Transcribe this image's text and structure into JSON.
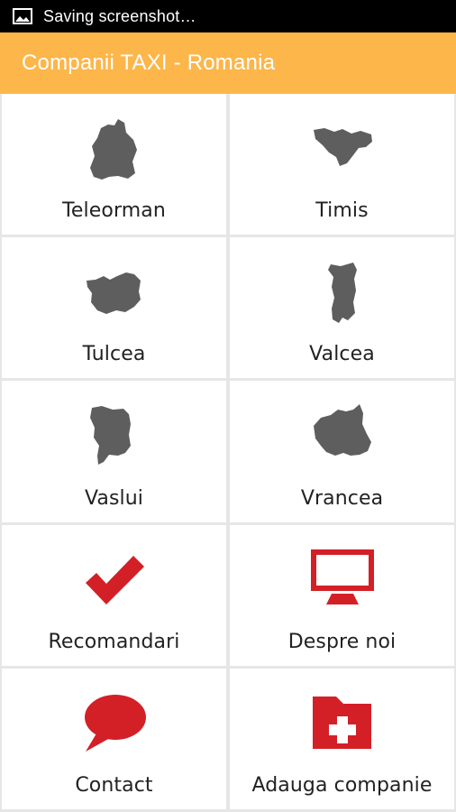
{
  "status_bar": {
    "text": "Saving screenshot…",
    "icon": "image-icon"
  },
  "app_bar": {
    "title": "Companii TAXI - Romania",
    "color": "#fcb64a"
  },
  "tiles": [
    {
      "label": "Teleorman",
      "icon": "teleorman-map-icon"
    },
    {
      "label": "Timis",
      "icon": "timis-map-icon"
    },
    {
      "label": "Tulcea",
      "icon": "tulcea-map-icon"
    },
    {
      "label": "Valcea",
      "icon": "valcea-map-icon"
    },
    {
      "label": "Vaslui",
      "icon": "vaslui-map-icon"
    },
    {
      "label": "Vrancea",
      "icon": "vrancea-map-icon"
    },
    {
      "label": "Recomandari",
      "icon": "checkmark-icon"
    },
    {
      "label": "Despre noi",
      "icon": "monitor-icon"
    },
    {
      "label": "Contact",
      "icon": "speech-bubble-icon"
    },
    {
      "label": "Adauga companie",
      "icon": "folder-plus-icon"
    }
  ],
  "colors": {
    "map_gray": "#5e5e5e",
    "accent_red": "#d32027",
    "background": "#e9e9e9",
    "tile": "#ffffff"
  }
}
